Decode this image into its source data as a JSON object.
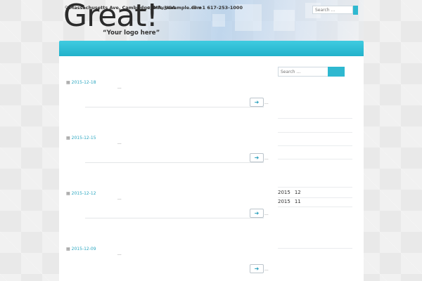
{
  "header": {
    "logo_text": "Great!",
    "tagline": "“Your logo here”",
    "address": "Massachusetts Ave, Cambridge, MA, USA",
    "email": "info@example.com",
    "phone": "+1 617-253-1000",
    "search_placeholder": "Search ...",
    "icons": {
      "address": "map-marker-icon",
      "email": "envelope-icon",
      "phone": "phone-icon"
    }
  },
  "colors": {
    "accent": "#29a6c0",
    "nav": "#2eb8d0",
    "content_bg": "#ffffff",
    "page_bg": "#e9e9e9"
  },
  "posts": [
    {
      "date": "2015-12-18",
      "excerpt": "...",
      "more": "..."
    },
    {
      "date": "2015-12-15",
      "excerpt": "...",
      "more": "..."
    },
    {
      "date": "2015-12-12",
      "excerpt": "...",
      "more": "..."
    },
    {
      "date": "2015-12-09",
      "excerpt": "...",
      "more": "..."
    }
  ],
  "sidebar": {
    "search_placeholder": "Search ...",
    "archives": [
      {
        "year": "2015",
        "month": "12"
      },
      {
        "year": "2015",
        "month": "11"
      }
    ]
  }
}
